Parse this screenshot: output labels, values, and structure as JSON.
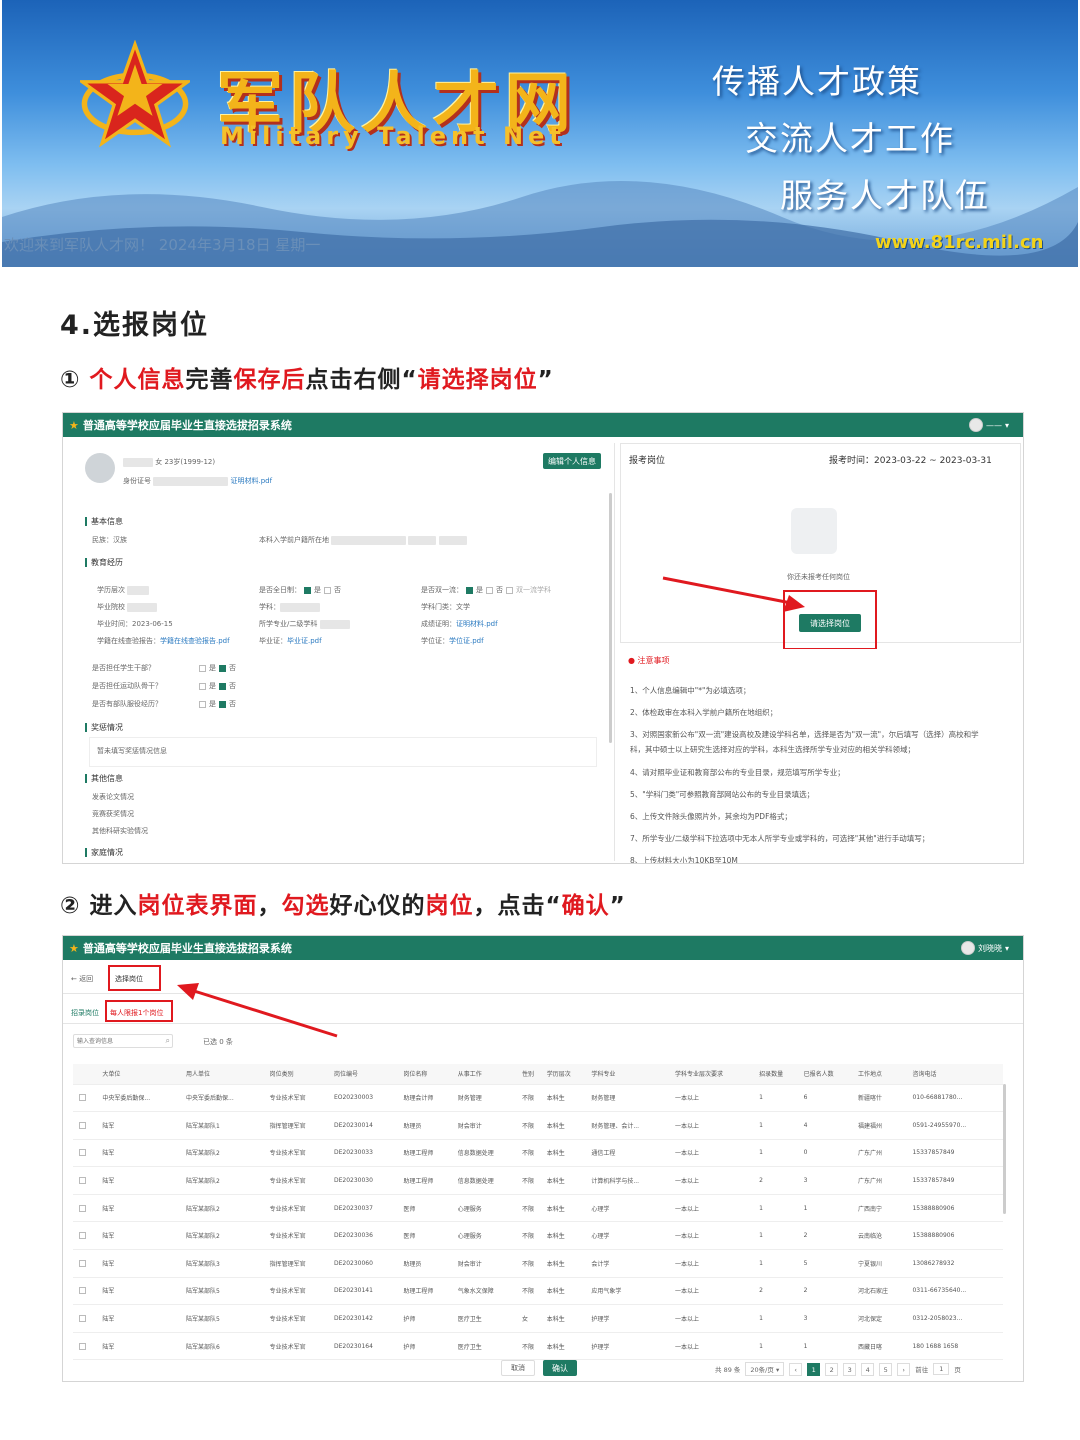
{
  "banner": {
    "title_cn": "军队人才网",
    "title_en": "Military Talent Net",
    "slogans": [
      "传播人才政策",
      "交流人才工作",
      "服务人才队伍"
    ],
    "welcome": "欢迎来到军队人才网！ 2024年3月18日 星期一",
    "url": "www.81rc.mil.cn"
  },
  "heading": "4.选报岗位",
  "step1": {
    "num": "①",
    "p1": "个人信息",
    "p2": "完善",
    "p3": "保存后",
    "p4": "点击右侧“",
    "p5": "请选择岗位",
    "p6": "”"
  },
  "step2": {
    "num": "②",
    "p1": "进入",
    "p2": "岗位表界面",
    "p3": "，",
    "p4": "勾选",
    "p5": "好心仪的",
    "p6": "岗位",
    "p7": "，点击“",
    "p8": "确认",
    "p9": "”"
  },
  "app": {
    "system_title": "普通高等学校应届毕业生直接选拔招录系统",
    "user1": "——",
    "user2": "刘晓晓",
    "profile": {
      "gender_age": "女 23岁(1999-12)",
      "id_label": "身份证号",
      "proof_file": "证明材料.pdf",
      "edit_button": "编辑个人信息",
      "sections": {
        "basic": "基本信息",
        "education": "教育经历",
        "awards": "奖惩情况",
        "other": "其他信息",
        "family": "家庭情况"
      },
      "ethnicity": "民族：汉族",
      "household": "本科入学前户籍所在地",
      "edu": {
        "level": "学历层次",
        "school": "毕业院校",
        "grad_time": "毕业时间：2023-06-15",
        "online_report_label": "学籍在线查验报告：",
        "online_report_file": "学籍在线查验报告.pdf",
        "fulltime": "是否全日制：",
        "yes": "是",
        "no": "否",
        "major": "学科：",
        "minor": "所学专业/二级学科",
        "diploma_label": "毕业证：",
        "diploma_file": "毕业证.pdf",
        "double_first": "是否双一流：",
        "double_first_major": "双一流学科",
        "subject_cat": "学科门类：文学",
        "score_label": "成绩证明：",
        "score_file": "证明材料.pdf",
        "degree_label": "学位证：",
        "degree_file": "学位证.pdf"
      },
      "questions": [
        "是否担任学生干部？",
        "是否担任运动队骨干？",
        "是否有部队服役经历？"
      ],
      "awards_text": "暂未填写奖惩情况信息",
      "other_items": [
        "发表论文情况",
        "竞赛获奖情况",
        "其他科研实验情况"
      ]
    },
    "apply": {
      "title": "报考岗位",
      "time_label": "报考时间：",
      "time_value": "2023-03-22 ~ 2023-03-31",
      "empty_text": "你还未报考任何岗位",
      "button": "请选择岗位"
    },
    "notes": {
      "title": "注意事项",
      "items": [
        "1、个人信息编辑中\"*\"为必填选项；",
        "2、体检政审在本科入学前户籍所在地组织；",
        "3、对照国家新公布\"双一流\"建设高校及建设学科名单，选择是否为\"双一流\"，尔后填写（选择）高校和学",
        "科，其中硕士以上研究生选择对应的学科，本科生选择所学专业对应的相关学科领域；",
        "4、请对照毕业证和教育部公布的专业目录，规范填写所学专业；",
        "5、\"学科门类\"可参照教育部网站公布的专业目录填选；",
        "6、上传文件除头像照片外，其余均为PDF格式；",
        "7、所学专业/二级学科下拉选项中无本人所学专业或学科的，可选择\"其他\"进行手动填写；",
        "8、上传材料大小为10KB至10M"
      ]
    },
    "select": {
      "back": "返回",
      "crumb": "选择岗位",
      "tab1": "招录岗位",
      "tab2": "每人限报1个岗位",
      "search_placeholder": "输入查询信息",
      "selected": "已选 0 条",
      "columns": [
        "大单位",
        "用人单位",
        "岗位类别",
        "岗位编号",
        "岗位名称",
        "从事工作",
        "性别",
        "学历层次",
        "学科专业",
        "学科专业层次要求",
        "招录数量",
        "已报名人数",
        "工作地点",
        "咨询电话"
      ],
      "rows": [
        [
          "中央军委后勤保...",
          "中央军委后勤保...",
          "专业技术军官",
          "EO20230003",
          "助理会计师",
          "财务管理",
          "不限",
          "本科生",
          "财务管理",
          "一本以上",
          "1",
          "6",
          "新疆喀什",
          "010-66881780..."
        ],
        [
          "陆军",
          "陆军某部队1",
          "指挥管理军官",
          "DE20230014",
          "助理员",
          "财会审计",
          "不限",
          "本科生",
          "财务管理、会计...",
          "一本以上",
          "1",
          "4",
          "福建福州",
          "0591-24955970..."
        ],
        [
          "陆军",
          "陆军某部队2",
          "专业技术军官",
          "DE20230033",
          "助理工程师",
          "信息数据处理",
          "不限",
          "本科生",
          "通信工程",
          "一本以上",
          "1",
          "0",
          "广东广州",
          "15337857849"
        ],
        [
          "陆军",
          "陆军某部队2",
          "专业技术军官",
          "DE20230030",
          "助理工程师",
          "信息数据处理",
          "不限",
          "本科生",
          "计算机科学与技...",
          "一本以上",
          "2",
          "3",
          "广东广州",
          "15337857849"
        ],
        [
          "陆军",
          "陆军某部队2",
          "专业技术军官",
          "DE20230037",
          "医师",
          "心理服务",
          "不限",
          "本科生",
          "心理学",
          "一本以上",
          "1",
          "1",
          "广西南宁",
          "15388880906"
        ],
        [
          "陆军",
          "陆军某部队2",
          "专业技术军官",
          "DE20230036",
          "医师",
          "心理服务",
          "不限",
          "本科生",
          "心理学",
          "一本以上",
          "1",
          "2",
          "云南临沧",
          "15388880906"
        ],
        [
          "陆军",
          "陆军某部队3",
          "指挥管理军官",
          "DE20230060",
          "助理员",
          "财会审计",
          "不限",
          "本科生",
          "会计学",
          "一本以上",
          "1",
          "5",
          "宁夏银川",
          "13086278932"
        ],
        [
          "陆军",
          "陆军某部队5",
          "专业技术军官",
          "DE20230141",
          "助理工程师",
          "气象水文保障",
          "不限",
          "本科生",
          "应用气象学",
          "一本以上",
          "2",
          "2",
          "河北石家庄",
          "0311-66735640..."
        ],
        [
          "陆军",
          "陆军某部队5",
          "专业技术军官",
          "DE20230142",
          "护师",
          "医疗卫生",
          "女",
          "本科生",
          "护理学",
          "一本以上",
          "1",
          "3",
          "河北保定",
          "0312-2058023..."
        ],
        [
          "陆军",
          "陆军某部队6",
          "专业技术军官",
          "DE20230164",
          "护师",
          "医疗卫生",
          "不限",
          "本科生",
          "护理学",
          "一本以上",
          "1",
          "1",
          "西藏日喀",
          "180 1688 1658"
        ]
      ],
      "cancel": "取消",
      "confirm": "确认",
      "total": "共 89 条",
      "per_page": "20条/页",
      "pages": [
        "1",
        "2",
        "3",
        "4",
        "5"
      ],
      "goto_label": "前往",
      "goto_value": "1",
      "goto_unit": "页"
    }
  },
  "colors": {
    "accent_red": "#e0191f",
    "system_green": "#1e7a63"
  }
}
